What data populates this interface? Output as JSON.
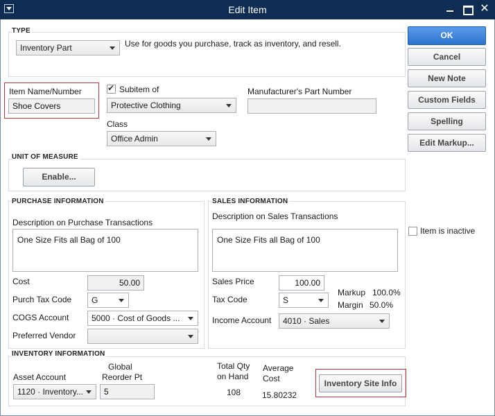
{
  "window": {
    "title": "Edit Item"
  },
  "type_section": {
    "title": "TYPE",
    "selected": "Inventory Part",
    "description": "Use for goods you purchase, track as inventory, and resell."
  },
  "item": {
    "name_label": "Item Name/Number",
    "name_value": "Shoe Covers",
    "subitem_label": "Subitem of",
    "subitem_checked": true,
    "subitem_value": "Protective Clothing",
    "mpn_label": "Manufacturer's Part Number",
    "mpn_value": "",
    "class_label": "Class",
    "class_value": "Office Admin"
  },
  "uom": {
    "title": "UNIT OF MEASURE",
    "enable_label": "Enable..."
  },
  "purchase": {
    "title": "PURCHASE INFORMATION",
    "desc_label": "Description on Purchase Transactions",
    "desc_value": "One Size Fits all Bag of 100",
    "cost_label": "Cost",
    "cost_value": "50.00",
    "tax_label": "Purch Tax Code",
    "tax_value": "G",
    "cogs_label": "COGS Account",
    "cogs_value": "5000 · Cost of Goods ...",
    "vendor_label": "Preferred Vendor",
    "vendor_value": ""
  },
  "sales": {
    "title": "SALES INFORMATION",
    "desc_label": "Description on Sales Transactions",
    "desc_value": "One Size Fits all Bag of 100",
    "price_label": "Sales Price",
    "price_value": "100.00",
    "tax_label": "Tax Code",
    "tax_value": "S",
    "markup_label": "Markup",
    "markup_value": "100.0%",
    "margin_label": "Margin",
    "margin_value": "50.0%",
    "income_label": "Income Account",
    "income_value": "4010 · Sales"
  },
  "inventory": {
    "title": "INVENTORY INFORMATION",
    "asset_label": "Asset Account",
    "asset_value": "1120 · Inventory...",
    "reorder_label_1": "Global",
    "reorder_label_2": "Reorder Pt",
    "reorder_value": "5",
    "qty_label_1": "Total Qty",
    "qty_label_2": "on Hand",
    "qty_value": "108",
    "avg_label_1": "Average",
    "avg_label_2": "Cost",
    "avg_value": "15.80232",
    "site_button": "Inventory Site Info"
  },
  "buttons": {
    "ok": "OK",
    "cancel": "Cancel",
    "new_note": "New Note",
    "custom_fields": "Custom Fields",
    "spelling": "Spelling",
    "edit_markup": "Edit Markup..."
  },
  "inactive": {
    "label": "Item is inactive",
    "checked": false
  },
  "colors": {
    "titlebar": "#0f2d52",
    "primary_button": "#2c72cf",
    "highlight_border": "#b33a3a"
  }
}
